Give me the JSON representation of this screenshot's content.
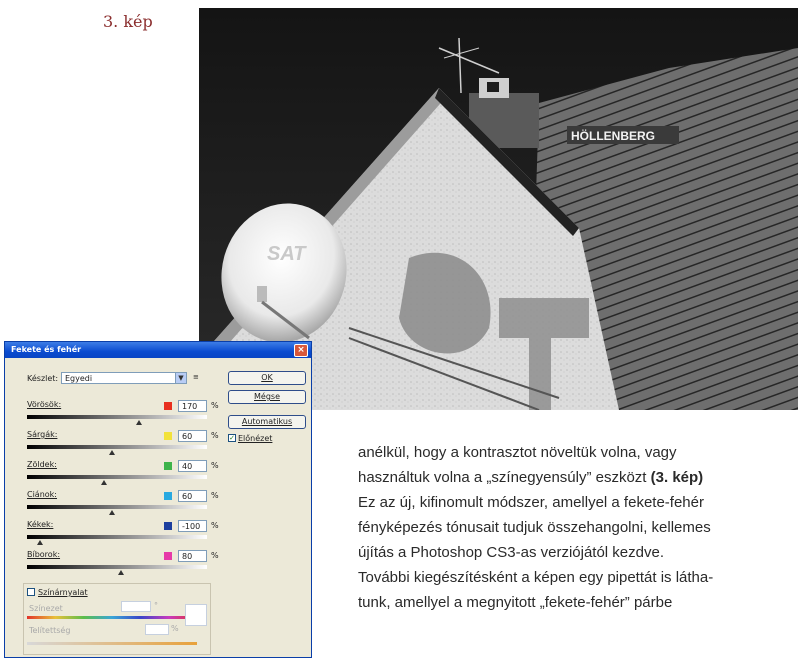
{
  "caption": "3. kép",
  "photo": {
    "sign_text": "HÖLLENBERG",
    "dish_text": "SAT"
  },
  "article": {
    "lines": [
      "anélkül, hogy a kontrasztot növeltük volna, vagy",
      "használtuk volna a „színegyensúly” eszközt ",
      "Ez az új, kifinomult módszer, amellyel a fekete-fehér",
      "fényképezés tónusait tudjuk összehangolni, kellemes",
      "újítás a Photoshop CS3-as verziójától kezdve.",
      "További kiegészítésként a képen egy pipettát is látha-",
      "tunk, amellyel a megnyitott „fekete-fehér” párbe"
    ],
    "ref_bold": "(3. kép)"
  },
  "dialog": {
    "title": "Fekete és fehér",
    "close": "×",
    "preset_label": "Készlet:",
    "preset_value": "Egyedi",
    "preset_menu": "≡",
    "buttons": {
      "ok": "OK",
      "cancel": "Mégse",
      "auto": "Automatikus"
    },
    "preview_label": "Előnézet",
    "sliders": [
      {
        "label": "Vörösök:",
        "value": "170",
        "color": "#e8301f",
        "level": 0.62
      },
      {
        "label": "Sárgák:",
        "value": "60",
        "color": "#f2e23a",
        "level": 0.47
      },
      {
        "label": "Zöldek:",
        "value": "40",
        "color": "#3db34a",
        "level": 0.43
      },
      {
        "label": "Ciánok:",
        "value": "60",
        "color": "#28a9e0",
        "level": 0.47
      },
      {
        "label": "Kékek:",
        "value": "-100",
        "color": "#1d3f9e",
        "level": 0.07
      },
      {
        "label": "Bíborok:",
        "value": "80",
        "color": "#e63aa8",
        "level": 0.52
      }
    ],
    "percent": "%",
    "tint": {
      "label": "Színárnyalat",
      "hue_label": "Színezet",
      "sat_label": "Telítettség",
      "degree": "°",
      "percent": "%"
    }
  }
}
